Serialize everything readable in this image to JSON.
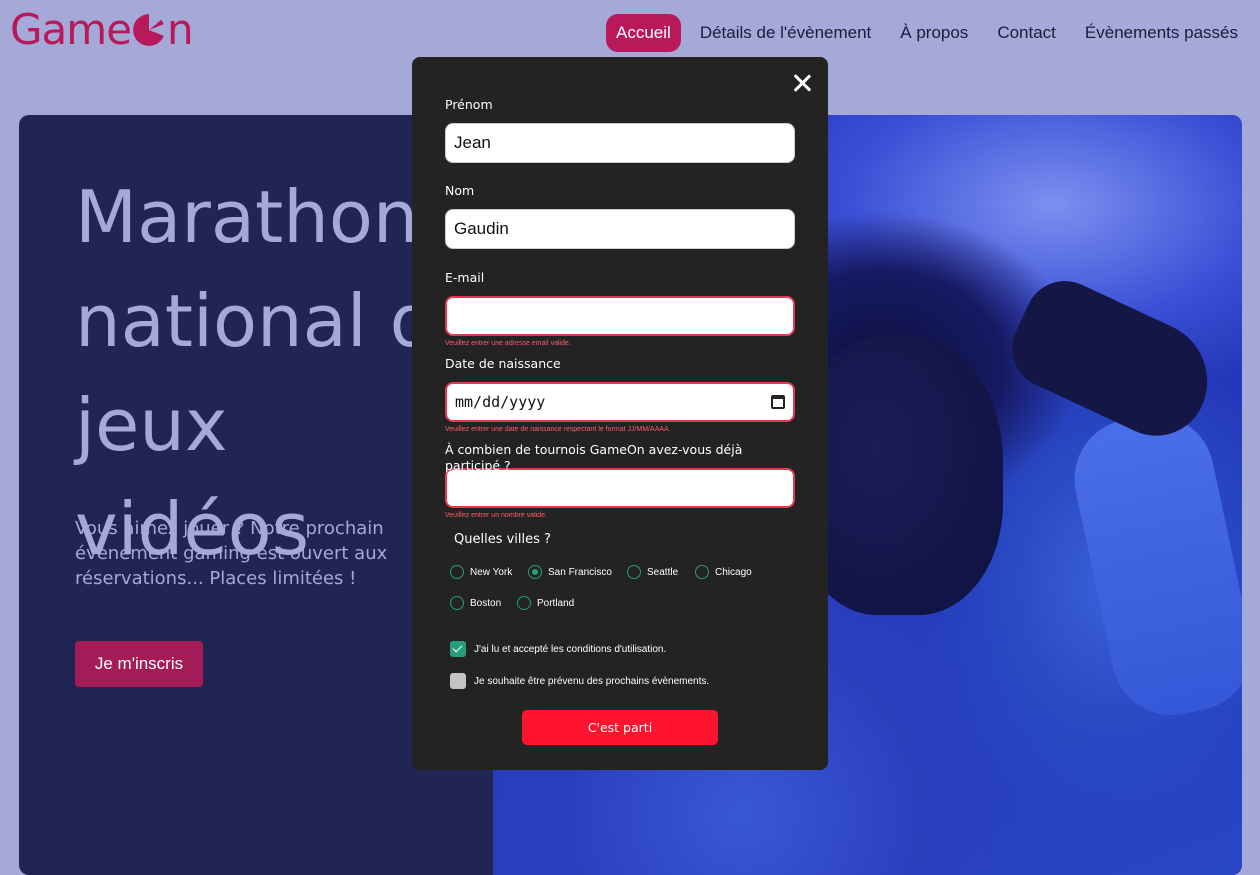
{
  "brand": {
    "logo_text_start": "Game",
    "logo_text_end": "n",
    "accent": "#b8195a"
  },
  "nav": {
    "items": [
      "Accueil",
      "Détails de l'évènement",
      "À propos",
      "Contact",
      "Évènements passés"
    ],
    "active_index": 0
  },
  "hero": {
    "title_lines": [
      "Marathon",
      "national de jeux",
      "vidéos"
    ],
    "text": "Vous aimez jouer ? Notre prochain évènement gaming est ouvert aux réservations... Places limitées !",
    "cta_label": "Je m'inscris"
  },
  "form": {
    "first_name": {
      "label": "Prénom",
      "value": "Jean"
    },
    "last_name": {
      "label": "Nom",
      "value": "Gaudin"
    },
    "email": {
      "label": "E-mail",
      "value": "",
      "error": "Veuillez entrer une adresse email valide."
    },
    "birthdate": {
      "label": "Date de naissance",
      "placeholder": "mm/dd/yyyy",
      "error": "Veuillez entrer une date de naissance respectant le format JJ/MM/AAAA."
    },
    "tournaments": {
      "label": "À combien de tournois GameOn avez-vous déjà participé ?",
      "value": "",
      "error": "Veuillez entrer un nombre valide."
    },
    "cities_title": "Quelles villes ?",
    "cities": [
      {
        "label": "New York",
        "checked": false
      },
      {
        "label": "San Francisco",
        "checked": true
      },
      {
        "label": "Seattle",
        "checked": false
      },
      {
        "label": "Chicago",
        "checked": false
      },
      {
        "label": "Boston",
        "checked": false
      },
      {
        "label": "Portland",
        "checked": false
      }
    ],
    "terms": {
      "label": "J'ai lu et accepté les conditions d'utilisation.",
      "checked": true
    },
    "newsletter": {
      "label": "Je souhaite être prévenu des prochains évènements.",
      "checked": false
    },
    "submit_label": "C'est parti",
    "colors": {
      "error": "#fe5c6d",
      "submit": "#fe142f",
      "check": "#279e7a"
    }
  }
}
